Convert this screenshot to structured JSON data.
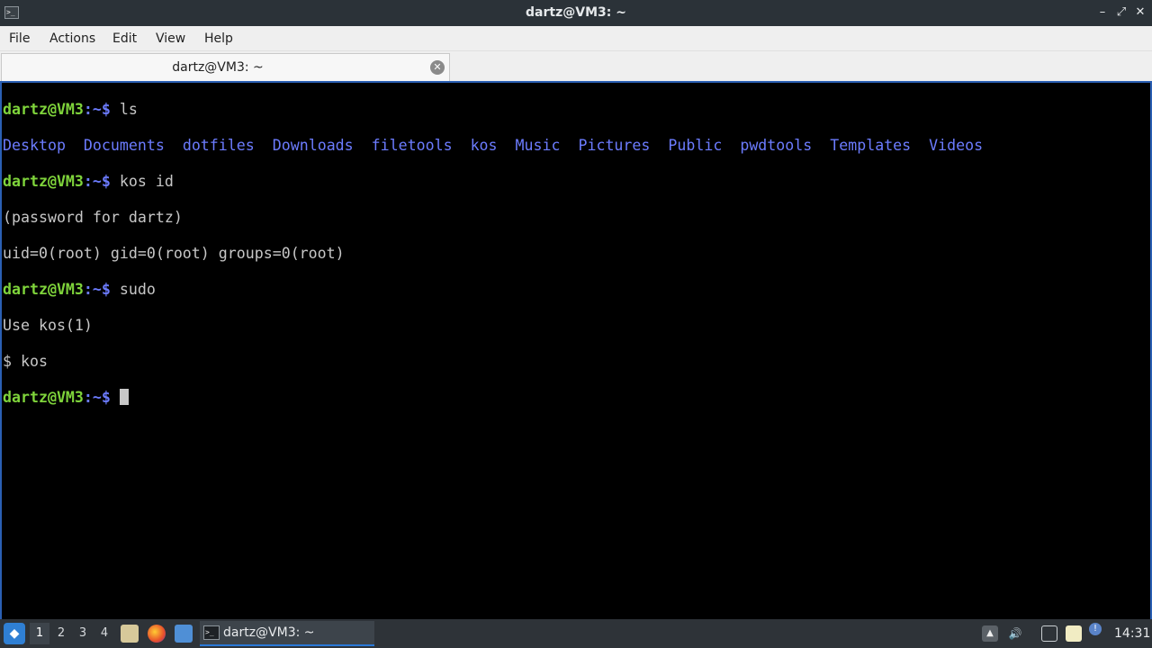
{
  "window": {
    "title": "dartz@VM3: ~",
    "app_icon_glyph": ">_",
    "minimize_glyph": "–",
    "maximize_glyph": "⤢",
    "close_glyph": "✕"
  },
  "menu": {
    "items": [
      {
        "label": "File"
      },
      {
        "label": "Actions"
      },
      {
        "label": "Edit"
      },
      {
        "label": "View"
      },
      {
        "label": "Help"
      }
    ]
  },
  "tabs": [
    {
      "label": "dartz@VM3: ~",
      "close_glyph": "✕"
    }
  ],
  "terminal": {
    "colors": {
      "prompt": "#7fd43b",
      "path": "#6c7cff",
      "text": "#c7c7c7",
      "dir": "#6c7cff",
      "background": "#000000"
    },
    "lines": [
      {
        "prompt": "dartz@VM3",
        "path": ":~$",
        "command": " ls"
      },
      {
        "dirs": [
          "Desktop",
          "Documents",
          "dotfiles",
          "Downloads",
          "filetools",
          "kos",
          "Music",
          "Pictures",
          "Public",
          "pwdtools",
          "Templates",
          "Videos"
        ]
      },
      {
        "prompt": "dartz@VM3",
        "path": ":~$",
        "command": " kos id"
      },
      {
        "text": "(password for dartz)"
      },
      {
        "text": "uid=0(root) gid=0(root) groups=0(root)"
      },
      {
        "prompt": "dartz@VM3",
        "path": ":~$",
        "command": " sudo"
      },
      {
        "text": "Use kos(1)"
      },
      {
        "text": "$ kos"
      },
      {
        "prompt": "dartz@VM3",
        "path": ":~$",
        "command": " "
      }
    ]
  },
  "taskbar": {
    "start_icon": "menu-icon",
    "workspaces": [
      {
        "label": "1",
        "active": true
      },
      {
        "label": "2",
        "active": false
      },
      {
        "label": "3",
        "active": false
      },
      {
        "label": "4",
        "active": false
      }
    ],
    "task_label": "dartz@VM3: ~",
    "task_icon_glyph": ">_",
    "clock": "14:31"
  }
}
